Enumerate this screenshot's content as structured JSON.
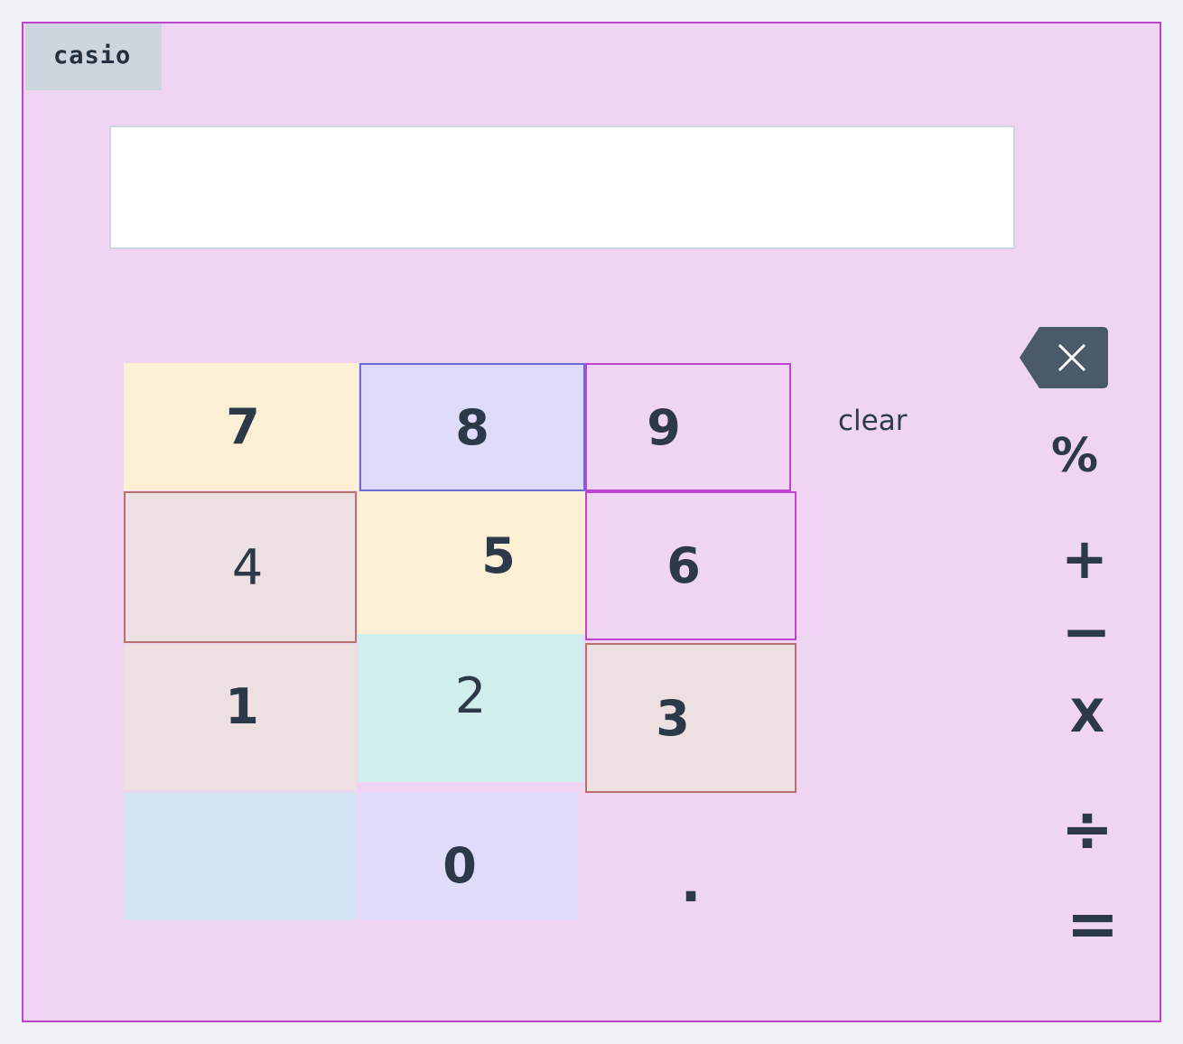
{
  "brand": "casio",
  "display": {
    "value": ""
  },
  "keys": {
    "k7": "7",
    "k8": "8",
    "k9": "9",
    "k4": "4",
    "k5": "5",
    "k6": "6",
    "k1": "1",
    "k2": "2",
    "k3": "3",
    "k0": "0",
    "dot": "."
  },
  "clear_label": "clear",
  "operators": {
    "percent": "%",
    "plus": "+",
    "minus": "−",
    "multiply": "X",
    "divide": "÷",
    "equals": "="
  },
  "icons": {
    "backspace": "backspace-icon"
  },
  "colors": {
    "panel": "#f0d5f3",
    "panel_border": "#c043cf",
    "text": "#2b3948",
    "backspace_bg": "#4a5a69"
  }
}
